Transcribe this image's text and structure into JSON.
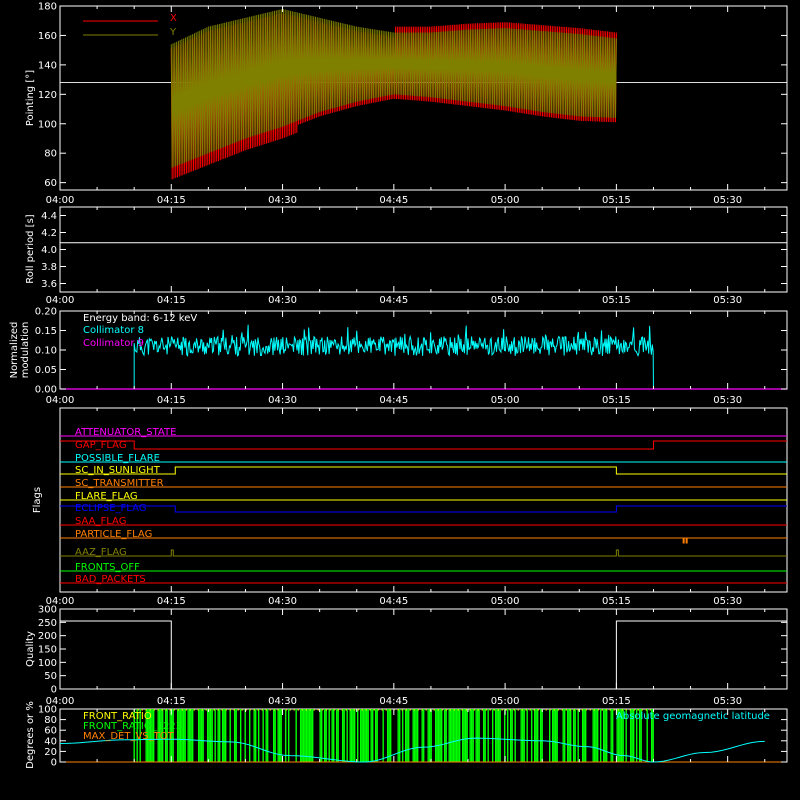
{
  "colors": {
    "background": "#000000",
    "axis": "#ffffff",
    "x_series": "#ff0000",
    "y_series": "#808000",
    "collimator8": "#00ffff",
    "collimator9": "#ff00ff",
    "front_ratio": "#ffff00",
    "front_ratio_1223": "#00ff00",
    "max_det_vs_tot": "#ff8000",
    "geomag": "#00ffff"
  },
  "time_ticks": [
    "04:00",
    "04:15",
    "04:30",
    "04:45",
    "05:00",
    "05:15",
    "05:30"
  ],
  "chart_data": [
    {
      "type": "line",
      "id": "pointing",
      "ylabel": "Pointing [°]",
      "ylim": [
        55,
        180
      ],
      "yticks": [
        "60",
        "80",
        "100",
        "120",
        "140",
        "160",
        "180"
      ],
      "reference_line": 128,
      "series": [
        {
          "name": "X",
          "color": "#ff0000"
        },
        {
          "name": "Y",
          "color": "#808000"
        }
      ],
      "x_minutes": [
        15,
        20,
        25,
        30,
        35,
        40,
        45,
        50,
        55,
        60,
        65,
        70,
        75
      ],
      "upper_envelope": [
        154,
        166,
        172,
        178,
        172,
        166,
        162,
        162,
        164,
        165,
        163,
        161,
        158
      ],
      "lower_envelope": [
        70,
        80,
        90,
        98,
        108,
        115,
        120,
        118,
        115,
        112,
        108,
        105,
        104
      ],
      "data_start": "04:15",
      "data_end": "05:15"
    },
    {
      "type": "line",
      "id": "roll-period",
      "ylabel": "Roll period [s]",
      "ylim": [
        3.5,
        4.5
      ],
      "yticks": [
        "3.6",
        "3.8",
        "4.0",
        "4.2",
        "4.4"
      ],
      "value": 4.08
    },
    {
      "type": "line",
      "id": "modulation",
      "ylabel": "Normalized\nmodulation",
      "ylim": [
        0,
        0.2
      ],
      "yticks": [
        "0.00",
        "0.05",
        "0.10",
        "0.15",
        "0.20"
      ],
      "annotation": "Energy band: 6-12 keV",
      "series": [
        {
          "name": "Collimator 8",
          "color": "#00ffff",
          "start": "04:10",
          "end": "05:20",
          "mean": 0.11
        },
        {
          "name": "Collimator 9",
          "color": "#ff00ff",
          "value": 0.0
        }
      ]
    },
    {
      "type": "line",
      "id": "flags",
      "ylabel": "Flags",
      "flags": [
        {
          "label": "ATTENUATOR_STATE",
          "color": "#ff00ff"
        },
        {
          "label": "GAP_FLAG",
          "color": "#ff0000"
        },
        {
          "label": "POSSIBLE_FLARE",
          "color": "#00ffff"
        },
        {
          "label": "SC_IN_SUNLIGHT",
          "color": "#ffff00"
        },
        {
          "label": "SC_TRANSMITTER",
          "color": "#ff8000"
        },
        {
          "label": "FLARE_FLAG",
          "color": "#ffff00"
        },
        {
          "label": "ECLIPSE_FLAG",
          "color": "#0000ff"
        },
        {
          "label": "SAA_FLAG",
          "color": "#ff0000"
        },
        {
          "label": "PARTICLE_FLAG",
          "color": "#ff8000"
        },
        {
          "label": "AAZ_FLAG",
          "color": "#808000"
        },
        {
          "label": "FRONTS_OFF",
          "color": "#00ff00"
        },
        {
          "label": "BAD_PACKETS",
          "color": "#ff0000"
        }
      ]
    },
    {
      "type": "line",
      "id": "quality",
      "ylabel": "Quality",
      "ylim": [
        0,
        300
      ],
      "yticks": [
        "0",
        "50",
        "100",
        "150",
        "200",
        "250",
        "300"
      ],
      "segments": [
        {
          "start": "04:00",
          "end": "04:15",
          "value": 255
        },
        {
          "start": "04:15",
          "end": "05:15",
          "value": 0
        },
        {
          "start": "05:15",
          "end": "05:38",
          "value": 255
        }
      ]
    },
    {
      "type": "line",
      "id": "ratios",
      "ylabel": "Degrees or %",
      "ylim": [
        0,
        100
      ],
      "yticks": [
        "0",
        "20",
        "40",
        "60",
        "80",
        "100"
      ],
      "series": [
        {
          "name": "FRONT_RATIO",
          "color": "#ffff00"
        },
        {
          "name": "FRONT_RATIO_1223",
          "color": "#00ff00"
        },
        {
          "name": "MAX_DET_VS_TOT",
          "color": "#ff8000"
        },
        {
          "name": "Absolute geomagnetic latitude",
          "color": "#00ffff"
        }
      ],
      "geomag_minutes": [
        0,
        9,
        15,
        23,
        31,
        41,
        49,
        56,
        65,
        71,
        76,
        80,
        87,
        95
      ],
      "geomag_values": [
        35,
        42,
        43,
        38,
        12,
        0,
        28,
        45,
        40,
        29,
        12,
        0,
        18,
        39
      ]
    }
  ]
}
